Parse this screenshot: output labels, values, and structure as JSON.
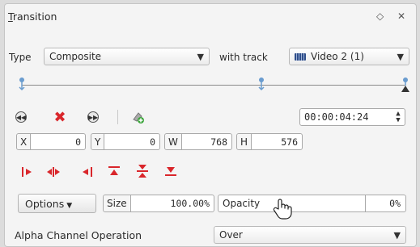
{
  "panel": {
    "title_prefix": "T",
    "title_rest": "ransition",
    "float_icon": "◇",
    "close_icon": "✕"
  },
  "type_row": {
    "type_label": "Type",
    "type_value": "Composite",
    "with_track_label": "with track",
    "track_value": "Video 2 (1)"
  },
  "keyframes": {
    "positions": [
      0.0,
      0.625,
      1.0
    ],
    "marker_color": "#6a9ccf",
    "selected_color": "#333333"
  },
  "toolbar": {
    "timecode": "00:00:04:24"
  },
  "geometry_fields": {
    "x_label": "X",
    "x_value": "0",
    "y_label": "Y",
    "y_value": "0",
    "w_label": "W",
    "w_value": "768",
    "h_label": "H",
    "h_value": "576"
  },
  "options": {
    "options_label": "Options",
    "size_label": "Size",
    "size_value": "100.00%",
    "opacity_label": "Opacity",
    "opacity_value": "0%"
  },
  "bottom": {
    "alpha_label": "Alpha Channel Operation",
    "alpha_value": "Over"
  },
  "colors": {
    "accent_red": "#d9262b",
    "keyframe_blue": "#6a9ccf",
    "track_icon_blue": "#2f4e8a"
  }
}
